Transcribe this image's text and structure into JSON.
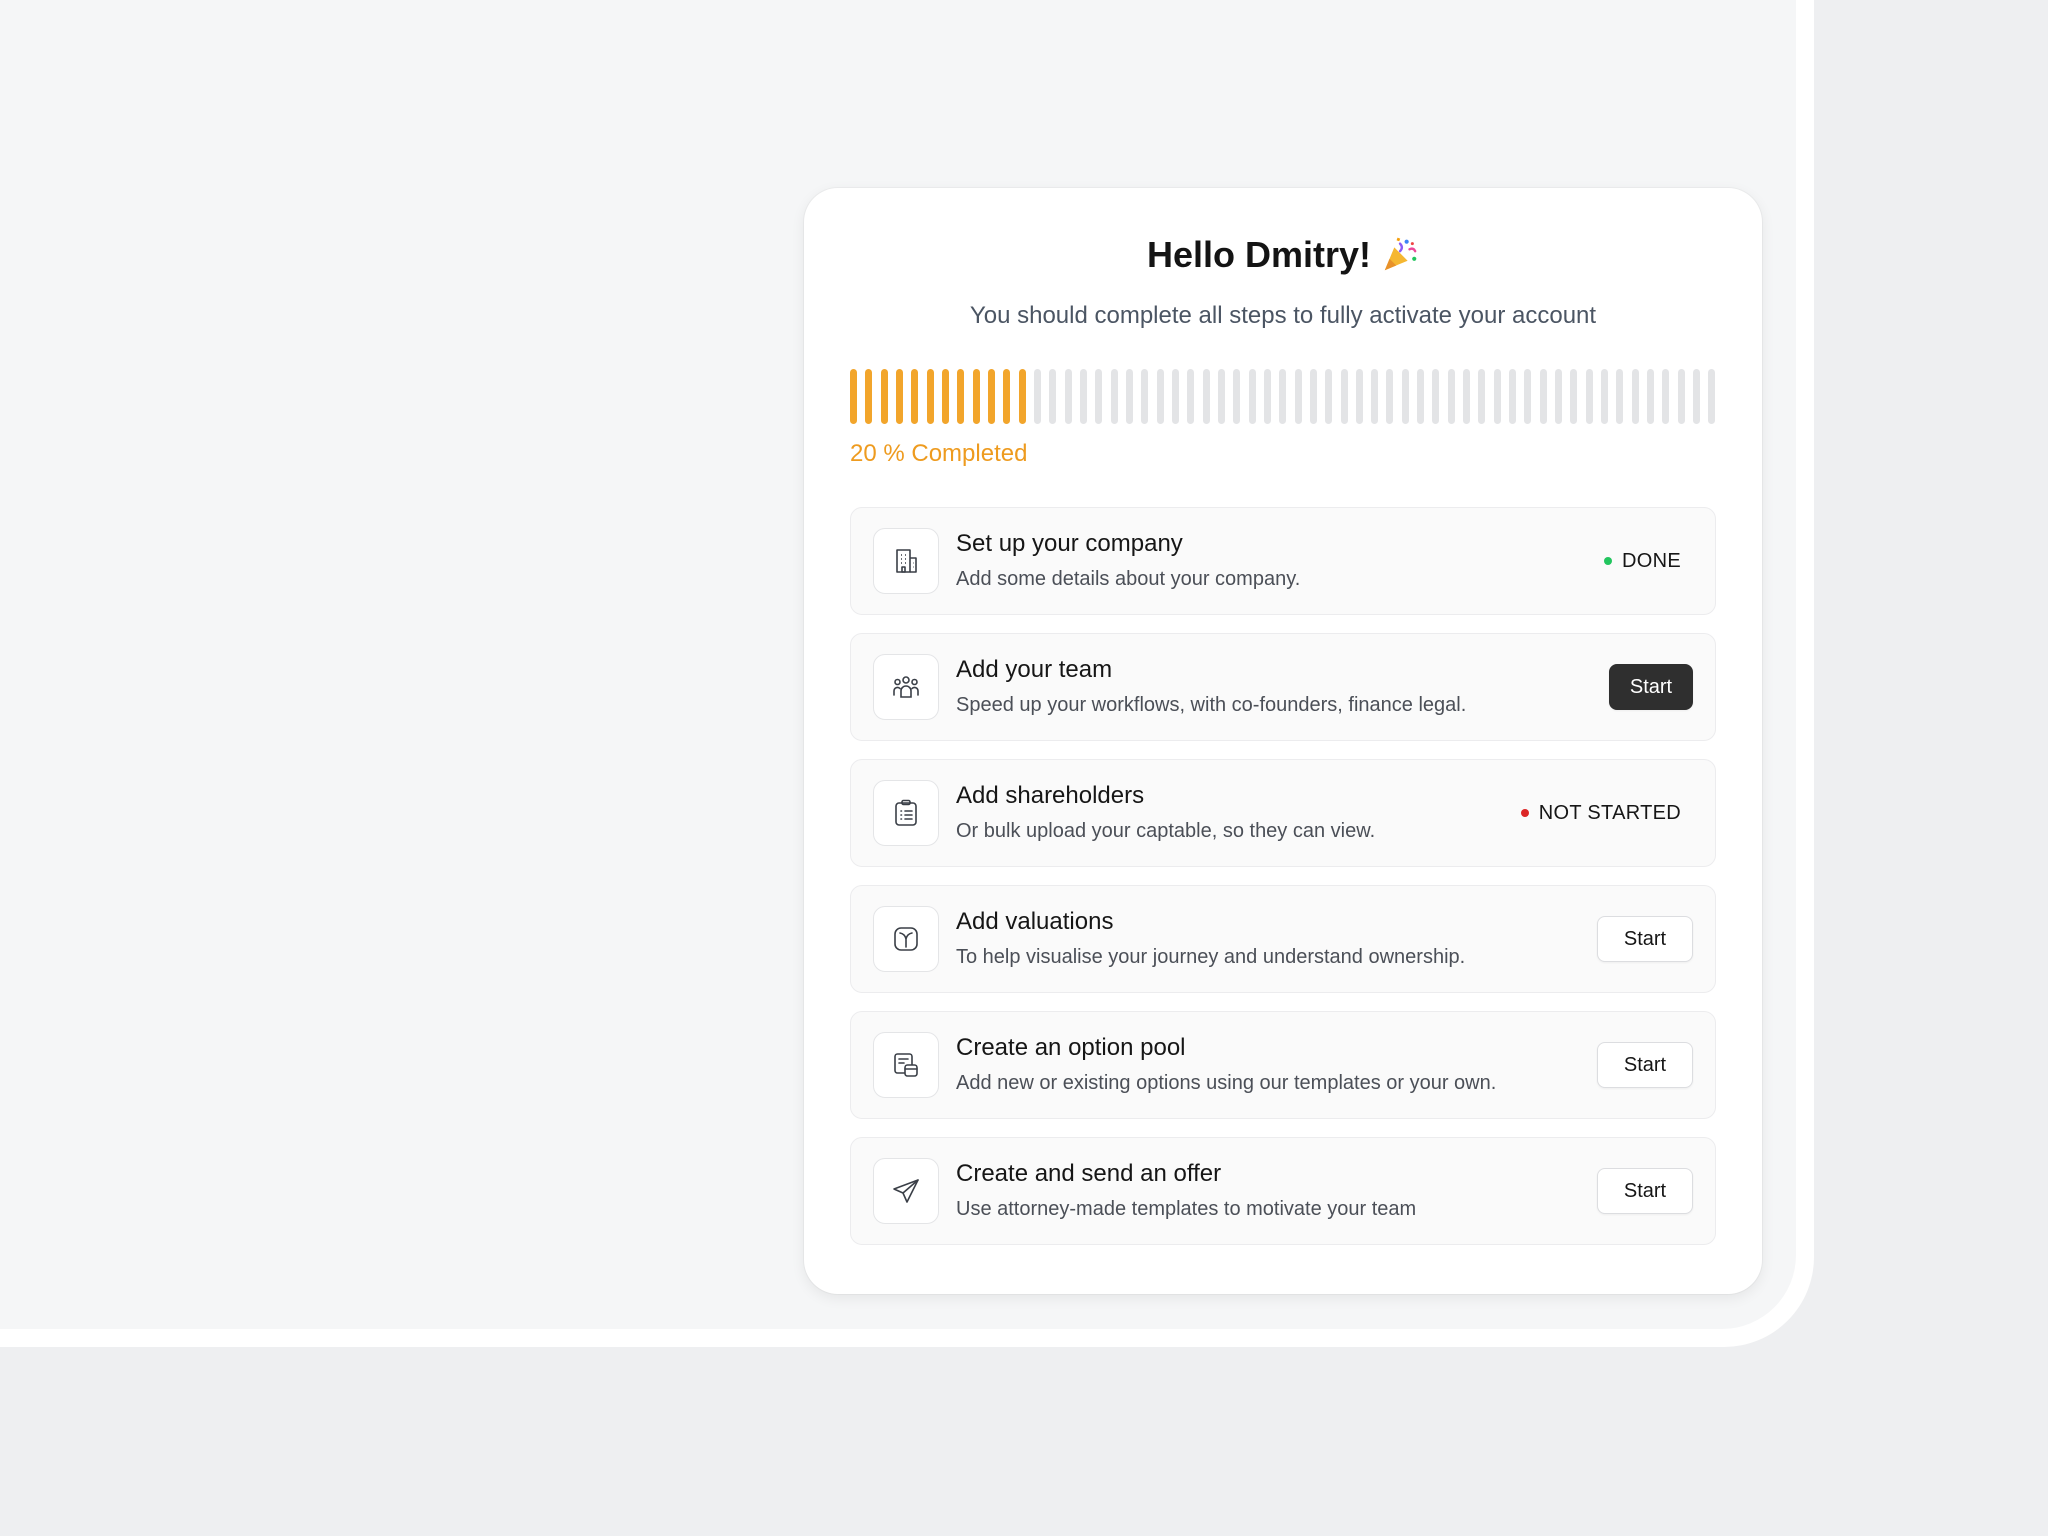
{
  "header": {
    "greeting": "Hello Dmitry!",
    "emoji_icon": "party-popper-icon",
    "subtitle": "You should complete all steps to fully activate your account"
  },
  "progress": {
    "percent": 20,
    "label": "20 % Completed",
    "total_ticks": 57,
    "filled_ticks": 12,
    "fill_color": "#f2a52b",
    "track_color": "#e3e4e6"
  },
  "steps": [
    {
      "title": "Set up your company",
      "description": "Add some details about your company.",
      "icon": "building-icon",
      "status": "DONE",
      "status_color": "#22c55e"
    },
    {
      "title": "Add your team",
      "description": "Speed up your workflows, with co-founders, finance legal.",
      "icon": "team-icon",
      "action": "Start",
      "action_style": "primary"
    },
    {
      "title": "Add shareholders",
      "description": "Or bulk upload your captable, so they can view.",
      "icon": "clipboard-list-icon",
      "status": "NOT STARTED",
      "status_color": "#dc2626"
    },
    {
      "title": "Add valuations",
      "description": "To help visualise your journey and understand ownership.",
      "icon": "valuation-icon",
      "action": "Start"
    },
    {
      "title": "Create an option pool",
      "description": "Add new or existing options using our templates or your own.",
      "icon": "option-pool-icon",
      "action": "Start"
    },
    {
      "title": "Create and send an offer",
      "description": "Use attorney-made templates to motivate your team",
      "icon": "paper-plane-icon",
      "action": "Start"
    }
  ]
}
